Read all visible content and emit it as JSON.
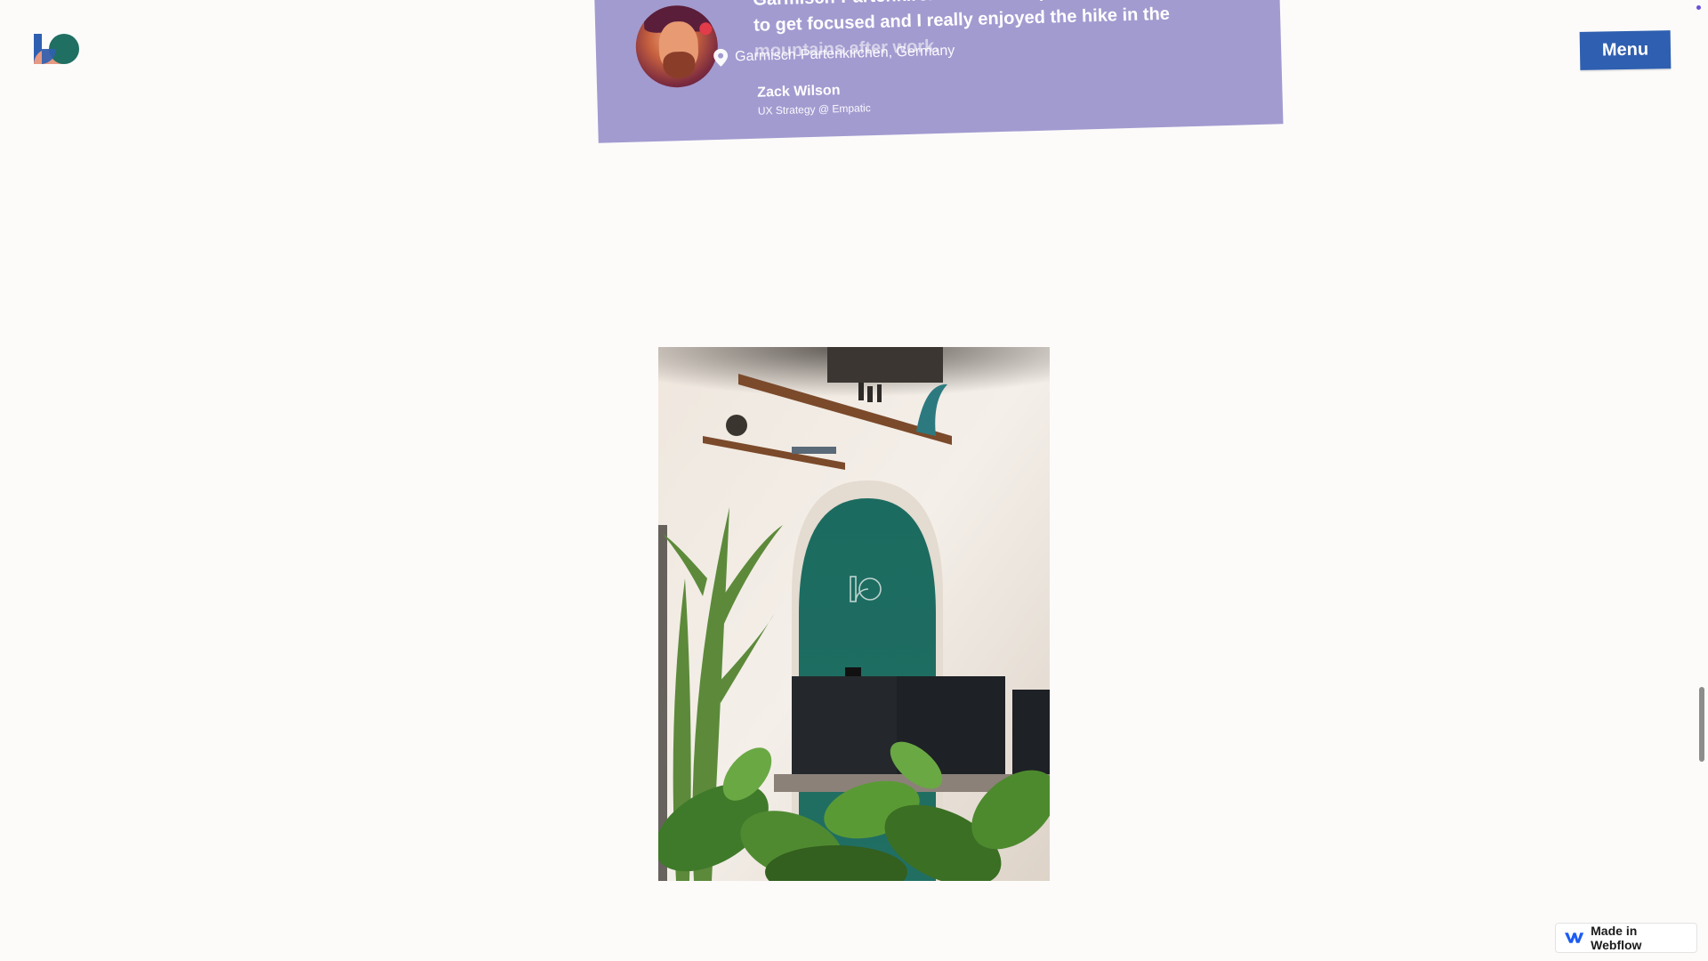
{
  "header": {
    "logo_alt": "logo",
    "menu_label": "Menu"
  },
  "testimonial": {
    "quote_line1": "Garmisch-Partenkirchen. The unique lifestyle",
    "quote_line2": "to get focused and I really enjoyed the hike in the",
    "quote_line3": "mountains after work.",
    "location": "Garmisch-Partenkirchen, Germany",
    "author_name": "Zack Wilson",
    "author_role": "UX Strategy @ Empatic"
  },
  "badge": {
    "label": "Made in Webflow"
  },
  "colors": {
    "background": "#fcfbfa",
    "card": "#a29bd0",
    "menu_button": "#2f5fb0",
    "arch_teal": "#1f6f63"
  }
}
